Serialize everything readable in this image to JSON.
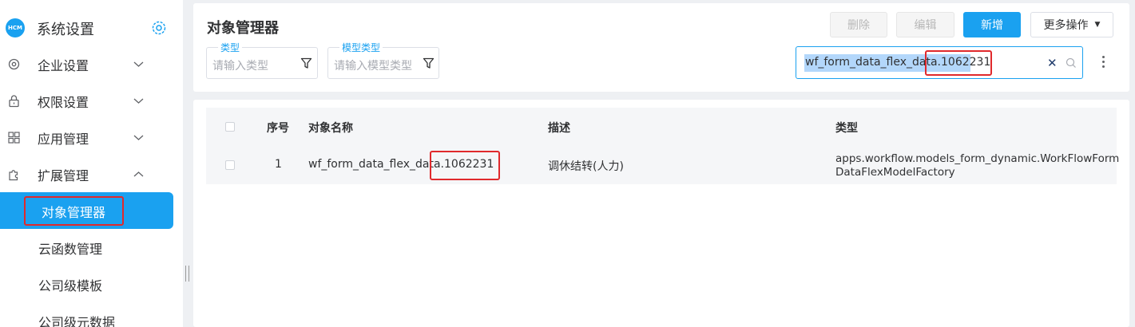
{
  "sidebar": {
    "brand_logo_text": "HCM",
    "brand_title": "系统设置",
    "menu": [
      {
        "label": "企业设置",
        "icon": "settings-icon",
        "expanded": false
      },
      {
        "label": "权限设置",
        "icon": "lock-icon",
        "expanded": false
      },
      {
        "label": "应用管理",
        "icon": "grid-icon",
        "expanded": false
      },
      {
        "label": "扩展管理",
        "icon": "puzzle-icon",
        "expanded": true
      }
    ],
    "submenu": [
      {
        "label": "对象管理器",
        "active": true
      },
      {
        "label": "云函数管理",
        "active": false
      },
      {
        "label": "公司级模板",
        "active": false
      },
      {
        "label": "公司级元数据",
        "active": false
      }
    ]
  },
  "header": {
    "title": "对象管理器",
    "buttons": {
      "delete": "删除",
      "edit": "编辑",
      "add": "新增",
      "more": "更多操作"
    },
    "filters": {
      "type_label": "类型",
      "type_placeholder": "请输入类型",
      "model_label": "模型类型",
      "model_placeholder": "请输入模型类型"
    },
    "search": {
      "value": "wf_form_data_flex_data.1062231"
    }
  },
  "table": {
    "columns": [
      "序号",
      "对象名称",
      "描述",
      "类型"
    ],
    "rows": [
      {
        "index": "1",
        "name": "wf_form_data_flex_data.1062231",
        "description": "调休结转(人力)",
        "type_line1": "apps.workflow.models_form_dynamic.WorkFlowForm",
        "type_line2": "DataFlexModelFactory"
      }
    ]
  },
  "colors": {
    "accent": "#1aa1f0",
    "highlight": "#e0292c",
    "background": "#eef0f3"
  }
}
